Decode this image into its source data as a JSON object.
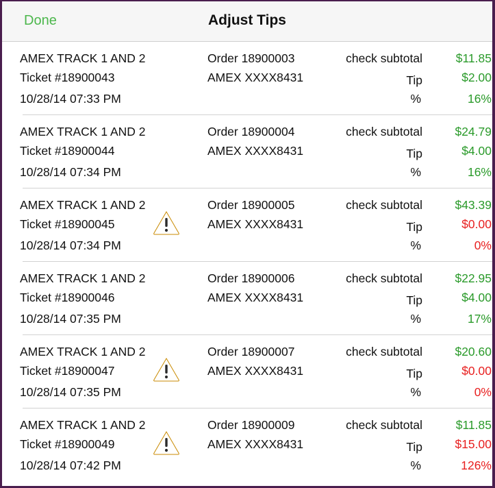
{
  "nav": {
    "done_label": "Done",
    "title": "Adjust Tips"
  },
  "labels": {
    "check_subtotal": "check subtotal",
    "tip": "Tip",
    "percent": "%"
  },
  "colors": {
    "accent": "#4cb74c",
    "positive": "#2a9a2a",
    "negative": "#e82020"
  },
  "rows": [
    {
      "card_type": "AMEX TRACK 1 AND 2",
      "ticket": "Ticket #18900043",
      "datetime": "10/28/14 07:33 PM",
      "order": "Order 18900003",
      "card_number": "AMEX XXXX8431",
      "subtotal": "$11.85",
      "tip": "$2.00",
      "percent": "16%",
      "warning": false,
      "status": "green"
    },
    {
      "card_type": "AMEX TRACK 1 AND 2",
      "ticket": "Ticket #18900044",
      "datetime": "10/28/14 07:34 PM",
      "order": "Order 18900004",
      "card_number": "AMEX XXXX8431",
      "subtotal": "$24.79",
      "tip": "$4.00",
      "percent": "16%",
      "warning": false,
      "status": "green"
    },
    {
      "card_type": "AMEX TRACK 1 AND 2",
      "ticket": "Ticket #18900045",
      "datetime": "10/28/14 07:34 PM",
      "order": "Order 18900005",
      "card_number": "AMEX XXXX8431",
      "subtotal": "$43.39",
      "tip": "$0.00",
      "percent": "0%",
      "warning": true,
      "status": "red"
    },
    {
      "card_type": "AMEX TRACK 1 AND 2",
      "ticket": "Ticket #18900046",
      "datetime": "10/28/14 07:35 PM",
      "order": "Order 18900006",
      "card_number": "AMEX XXXX8431",
      "subtotal": "$22.95",
      "tip": "$4.00",
      "percent": "17%",
      "warning": false,
      "status": "green"
    },
    {
      "card_type": "AMEX TRACK 1 AND 2",
      "ticket": "Ticket #18900047",
      "datetime": "10/28/14 07:35 PM",
      "order": "Order 18900007",
      "card_number": "AMEX XXXX8431",
      "subtotal": "$20.60",
      "tip": "$0.00",
      "percent": "0%",
      "warning": true,
      "status": "red"
    },
    {
      "card_type": "AMEX TRACK 1 AND 2",
      "ticket": "Ticket #18900049",
      "datetime": "10/28/14 07:42 PM",
      "order": "Order 18900009",
      "card_number": "AMEX XXXX8431",
      "subtotal": "$11.85",
      "tip": "$15.00",
      "percent": "126%",
      "warning": true,
      "status": "red"
    }
  ]
}
